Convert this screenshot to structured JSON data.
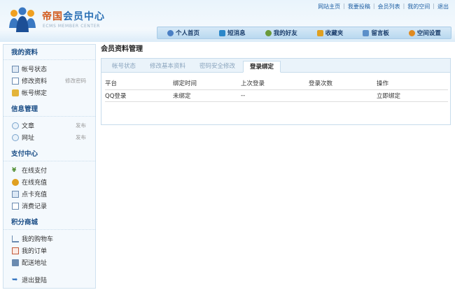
{
  "header": {
    "brand_red": "帝国",
    "brand_blue": "会员中心",
    "brand_sub": "ECMS MEMBER CENTER",
    "top_links": [
      "网站主页",
      "我要投稿",
      "会员列表",
      "我的空间",
      "退出"
    ],
    "nav": [
      {
        "label": "个人首页",
        "icon": "user-icon",
        "color": "#4a7fc4"
      },
      {
        "label": "短消息",
        "icon": "message-icon",
        "color": "#2b87c9"
      },
      {
        "label": "我的好友",
        "icon": "friends-icon",
        "color": "#6a9a3a"
      },
      {
        "label": "收藏夹",
        "icon": "star-icon",
        "color": "#e0a020"
      },
      {
        "label": "留言板",
        "icon": "board-icon",
        "color": "#5b8fc9"
      },
      {
        "label": "空间设置",
        "icon": "settings-icon",
        "color": "#e08a20"
      }
    ]
  },
  "sidebar": {
    "sections": [
      {
        "title": "我的资料",
        "items": [
          {
            "label": "帐号状态",
            "icon": "account-icon",
            "action": ""
          },
          {
            "label": "修改资料",
            "icon": "edit-icon",
            "action": "修改密码"
          },
          {
            "label": "帐号绑定",
            "icon": "lock-icon",
            "action": ""
          }
        ]
      },
      {
        "title": "信息管理",
        "items": [
          {
            "label": "文章",
            "icon": "article-icon",
            "action": "发布"
          },
          {
            "label": "网址",
            "icon": "link-icon",
            "action": "发布"
          }
        ]
      },
      {
        "title": "支付中心",
        "items": [
          {
            "label": "在线支付",
            "icon": "yen-icon",
            "action": ""
          },
          {
            "label": "在线充值",
            "icon": "coins-icon",
            "action": ""
          },
          {
            "label": "点卡充值",
            "icon": "card-icon",
            "action": ""
          },
          {
            "label": "消费记录",
            "icon": "record-icon",
            "action": ""
          }
        ]
      },
      {
        "title": "积分商城",
        "items": [
          {
            "label": "我的购物车",
            "icon": "cart-icon",
            "action": ""
          },
          {
            "label": "我的订单",
            "icon": "order-icon",
            "action": ""
          },
          {
            "label": "配送地址",
            "icon": "truck-icon",
            "action": ""
          }
        ]
      }
    ],
    "logout": "退出登陆"
  },
  "main": {
    "title": "会员资料管理",
    "tabs": [
      "帐号状态",
      "修改基本资料",
      "密码安全修改",
      "登录绑定"
    ],
    "active_tab": 3,
    "table": {
      "headers": [
        "平台",
        "绑定时间",
        "上次登录",
        "登录次数",
        "操作"
      ],
      "rows": [
        [
          "QQ登录",
          "未绑定",
          "--",
          "",
          "立即绑定"
        ]
      ]
    }
  },
  "colors": {
    "accent": "#1a4d86",
    "brand_red": "#d25a1c",
    "brand_blue": "#2a6fb4"
  }
}
